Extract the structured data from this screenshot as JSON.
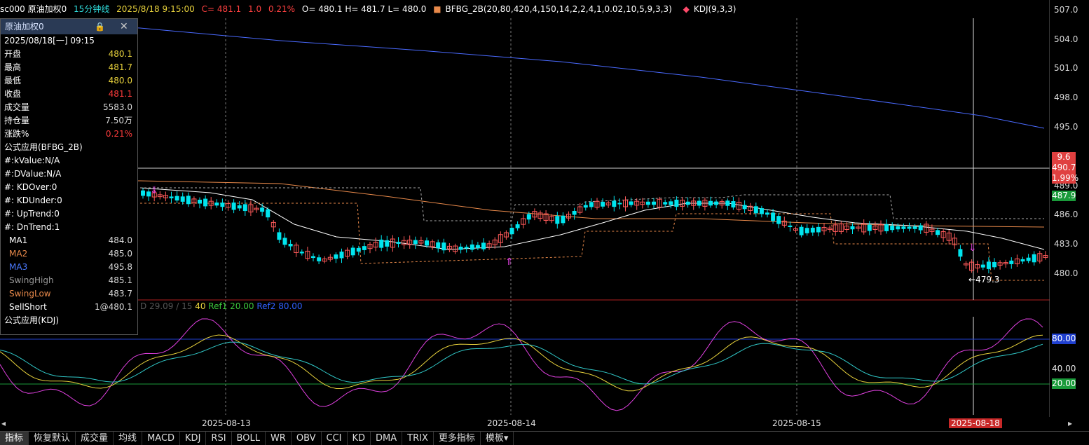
{
  "topbar": {
    "symbol": "sc000 原油加权0",
    "period": "15分钟线",
    "datetime": "2025/8/18 9:15:00",
    "change_label": "C= 481.1",
    "change_abs": "1.0",
    "change_pct": "0.21%",
    "ohl": "O= 480.1  H= 481.7  L= 480.0",
    "formula1": "BFBG_2B(20,80,420,4,150,14,2,2,4,1,0.02,10,5,9,3,3)",
    "formula2": "KDJ(9,3,3)"
  },
  "panel": {
    "title": "原油加权0",
    "datetime": "2025/08/18[一] 09:15",
    "rows": [
      {
        "label": "开盘",
        "value": "480.1",
        "color": "#e8d23c"
      },
      {
        "label": "最高",
        "value": "481.7",
        "color": "#e8d23c"
      },
      {
        "label": "最低",
        "value": "480.0",
        "color": "#e8d23c"
      },
      {
        "label": "收盘",
        "value": "481.1",
        "color": "#ff3c3c"
      },
      {
        "label": "成交量",
        "value": "5583.0",
        "color": "#d8d8d8"
      },
      {
        "label": "持仓量",
        "value": "7.50万",
        "color": "#d8d8d8"
      },
      {
        "label": "涨跌%",
        "value": "0.21%",
        "color": "#ff3c3c"
      }
    ],
    "formula_title": "公式应用(BFBG_2B)",
    "flags": [
      "#:kValue:N/A",
      "#:DValue:N/A",
      "#: KDOver:0",
      "#: KDUnder:0",
      "#: UpTrend:0",
      "#: DnTrend:1"
    ],
    "indicators": [
      {
        "label": "MA1",
        "value": "484.0",
        "color": "#ffffff"
      },
      {
        "label": "MA2",
        "value": "485.0",
        "color": "#e8894a"
      },
      {
        "label": "MA3",
        "value": "495.8",
        "color": "#4a7aff"
      },
      {
        "label": "SwingHigh",
        "value": "485.1",
        "color": "#9a9a9a"
      },
      {
        "label": "SwingLow",
        "value": "483.7",
        "color": "#e8894a"
      },
      {
        "label": "SellShort",
        "value": "1@480.1",
        "color": "#ffffff"
      }
    ],
    "kdj_title": "公式应用(KDJ)"
  },
  "kdj_header": {
    "prefix": "D 29.09 / 15",
    "mid": "40",
    "ref1": "Ref1 20.00",
    "ref2": "Ref2 80.00"
  },
  "axis": {
    "price_ticks": [
      "507.0",
      "504.0",
      "501.0",
      "498.0",
      "495.0",
      "489.0",
      "486.0",
      "483.0",
      "480.0"
    ],
    "marker_top": "9.6",
    "marker_price": "490.7",
    "marker_pct": "1.99%",
    "marker_last": "487.9",
    "kdj_ticks": [
      "40.00",
      "20.00"
    ],
    "kdj_marker_80": "80.00"
  },
  "annotations": {
    "low_label": "479.3"
  },
  "dates": [
    "2025-08-13",
    "2025-08-14",
    "2025-08-15",
    "2025-08-18"
  ],
  "bottom_tabs": [
    "指标",
    "恢复默认",
    "成交量",
    "均线",
    "MACD",
    "KDJ",
    "RSI",
    "BOLL",
    "WR",
    "OBV",
    "CCI",
    "KD",
    "DMA",
    "TRIX",
    "更多指标",
    "模板▾"
  ],
  "colors": {
    "up": "#ff5a5a",
    "down": "#00e5ee",
    "ma1": "#ffffff",
    "ma2": "#e8894a",
    "ma3": "#4a7aff",
    "k": "#e040e0",
    "d": "#e8d23c",
    "j": "#30c8c8"
  }
}
